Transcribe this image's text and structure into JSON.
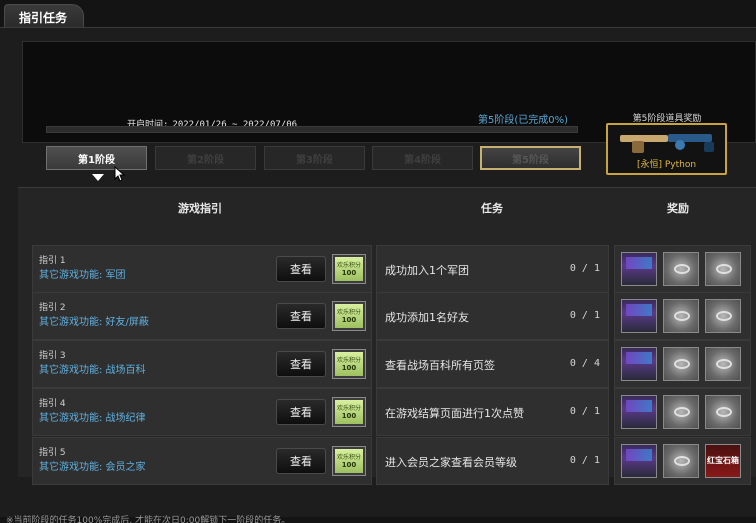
{
  "window": {
    "tab_title": "指引任务"
  },
  "banner": {
    "open_time_label": "开启时间:",
    "open_time_value": "2022/01/26 ~ 2022/07/06"
  },
  "stage_status": "第5阶段(已完成0%)",
  "progress_percent": 0,
  "stages": [
    {
      "label": "第1阶段",
      "state": "active"
    },
    {
      "label": "第2阶段",
      "state": "locked"
    },
    {
      "label": "第3阶段",
      "state": "locked"
    },
    {
      "label": "第4阶段",
      "state": "locked"
    },
    {
      "label": "第5阶段",
      "state": "goal"
    }
  ],
  "reward_preview": {
    "label": "第5阶段道具奖励",
    "item_name": "[永恒] Python"
  },
  "columns": {
    "guide": "游戏指引",
    "task": "任务",
    "reward": "奖励"
  },
  "view_label": "查看",
  "ticket": {
    "text": "欢乐积分",
    "amount": "100"
  },
  "rows": [
    {
      "num": "指引 1",
      "name": "其它游戏功能: 军团",
      "task": "成功加入1个军团",
      "progress": "0 / 1",
      "rewards": [
        "gem",
        "ring",
        "ring"
      ]
    },
    {
      "num": "指引 2",
      "name": "其它游戏功能: 好友/屏蔽",
      "task": "成功添加1名好友",
      "progress": "0 / 1",
      "rewards": [
        "gem",
        "ring",
        "ring"
      ]
    },
    {
      "num": "指引 3",
      "name": "其它游戏功能: 战场百科",
      "task": "查看战场百科所有页签",
      "progress": "0 / 4",
      "rewards": [
        "gem",
        "ring",
        "ring"
      ]
    },
    {
      "num": "指引 4",
      "name": "其它游戏功能: 战场纪律",
      "task": "在游戏结算页面进行1次点赞",
      "progress": "0 / 1",
      "rewards": [
        "gem",
        "ring",
        "ring"
      ]
    },
    {
      "num": "指引 5",
      "name": "其它游戏功能: 会员之家",
      "task": "进入会员之家查看会员等级",
      "progress": "0 / 1",
      "rewards": [
        "gem",
        "ring",
        "red"
      ]
    }
  ],
  "red_reward_label": "红宝石箱",
  "footer_note": "※当前阶段的任务100%完成后, 才能在次日0:00解锁下一阶段的任务。",
  "colors": {
    "accent_blue": "#5fb0e0",
    "gold": "#c9a43c",
    "ticket_green": "#9ec060"
  }
}
